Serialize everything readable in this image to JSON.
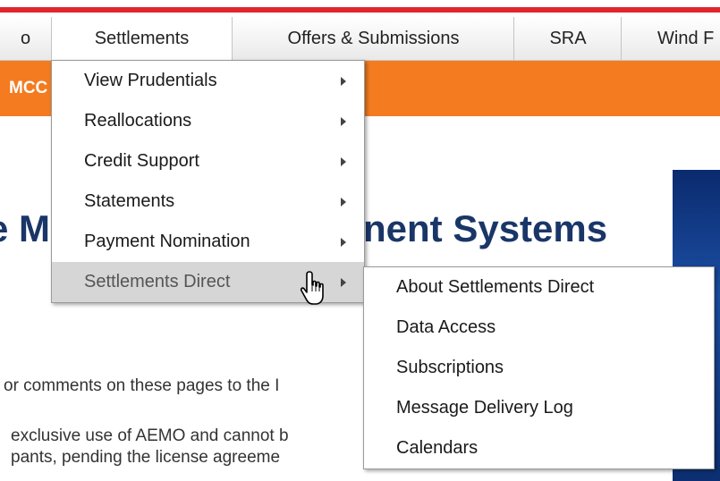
{
  "nav": {
    "items": [
      {
        "label": "o"
      },
      {
        "label": "Settlements"
      },
      {
        "label": "Offers & Submissions"
      },
      {
        "label": "SRA"
      },
      {
        "label": "Wind F"
      }
    ]
  },
  "orange_bar": {
    "text": "MCC"
  },
  "page": {
    "heading_left": "e M",
    "heading_right": "nent Systems",
    "line1": "or comments on these pages to the I",
    "line2": "exclusive use of AEMO and cannot b",
    "line3": "pants, pending the license agreeme"
  },
  "settlements_menu": {
    "items": [
      {
        "label": "View Prudentials"
      },
      {
        "label": "Reallocations"
      },
      {
        "label": "Credit Support"
      },
      {
        "label": "Statements"
      },
      {
        "label": "Payment Nomination"
      },
      {
        "label": "Settlements Direct"
      }
    ]
  },
  "settlements_direct_menu": {
    "items": [
      {
        "label": "About Settlements Direct"
      },
      {
        "label": "Data Access"
      },
      {
        "label": "Subscriptions"
      },
      {
        "label": "Message Delivery Log"
      },
      {
        "label": "Calendars"
      }
    ]
  },
  "icons": {
    "cursor": "hand-pointer-icon",
    "submenu_arrow": "arrow-right-icon"
  },
  "colors": {
    "accent_red": "#e0262f",
    "orange": "#f47b20",
    "heading_blue": "#1a3668"
  }
}
